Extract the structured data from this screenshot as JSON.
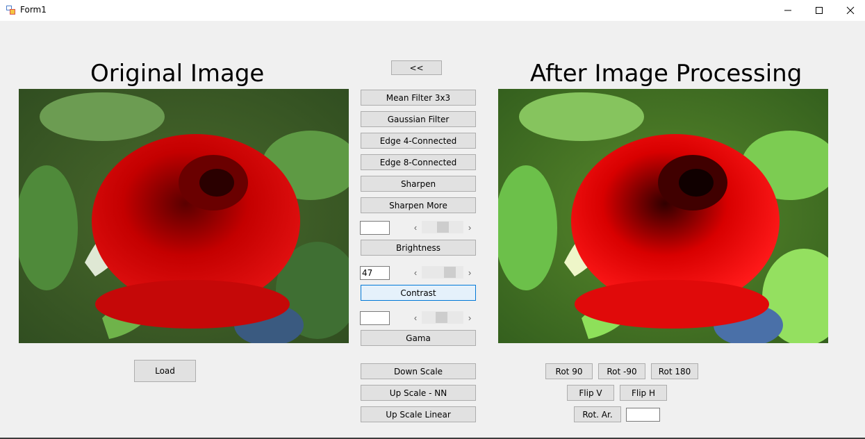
{
  "window": {
    "title": "Form1"
  },
  "headings": {
    "original": "Original Image",
    "processed": "After Image Processing"
  },
  "buttons": {
    "back": "<<",
    "mean_filter": "Mean Filter 3x3",
    "gaussian": "Gaussian Filter",
    "edge4": "Edge 4-Connected",
    "edge8": "Edge 8-Connected",
    "sharpen": "Sharpen",
    "sharpen_more": "Sharpen More",
    "brightness": "Brightness",
    "contrast": "Contrast",
    "gama": "Gama",
    "load": "Load",
    "down_scale": "Down Scale",
    "up_scale_nn": "Up Scale - NN",
    "up_scale_linear": "Up Scale Linear",
    "rot90": "Rot 90",
    "rot_neg90": "Rot -90",
    "rot180": "Rot 180",
    "flip_v": "Flip V",
    "flip_h": "Flip H",
    "rot_ar": "Rot. Ar."
  },
  "inputs": {
    "brightness_value": "",
    "contrast_value": "47",
    "gama_value": "",
    "rot_ar_value": ""
  },
  "scrollbars": {
    "left_arrow": "‹",
    "right_arrow": "›"
  },
  "icons": {
    "app": "form-app-icon",
    "minimize": "minimize-icon",
    "maximize": "maximize-icon",
    "close": "close-icon"
  },
  "colors": {
    "button_face": "#e1e1e1",
    "focus_border": "#0078d7",
    "form_background": "#f0f0f0"
  }
}
